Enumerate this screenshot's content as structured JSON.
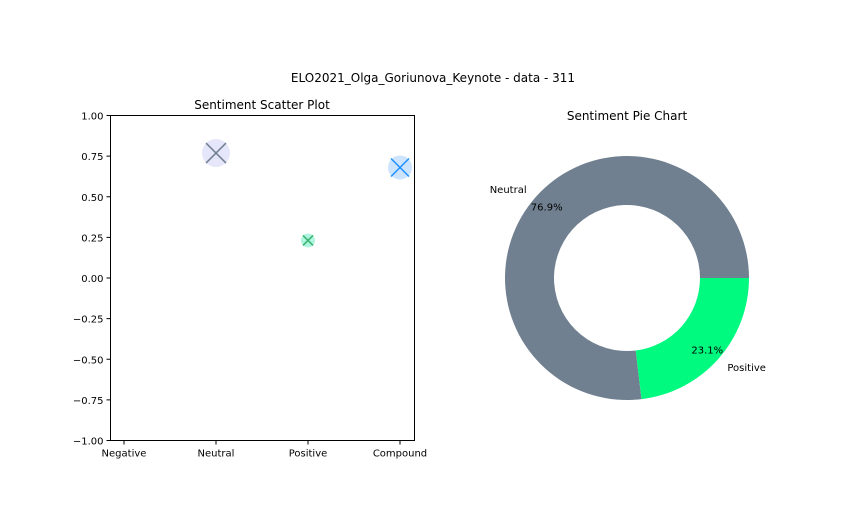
{
  "figure": {
    "suptitle": "ELO2021_Olga_Goriunova_Keynote - data - 311"
  },
  "chart_data": [
    {
      "type": "scatter",
      "title": "Sentiment Scatter Plot",
      "xlabel": "",
      "ylabel": "",
      "categories": [
        "Negative",
        "Neutral",
        "Positive",
        "Compound"
      ],
      "ylim": [
        -1.0,
        1.0
      ],
      "yticks": [
        "1.00",
        "0.75",
        "0.50",
        "0.25",
        "0.00",
        "−0.25",
        "−0.50",
        "−0.75",
        "−1.00"
      ],
      "yticks_values": [
        1.0,
        0.75,
        0.5,
        0.25,
        0.0,
        -0.25,
        -0.5,
        -0.75,
        -1.0
      ],
      "points": [
        {
          "category": "Neutral",
          "value": 0.769,
          "marker": "x",
          "color": "#708090",
          "halo": "#e6e6fa",
          "size": "large"
        },
        {
          "category": "Positive",
          "value": 0.231,
          "marker": "x",
          "color": "#3cb371",
          "halo": "#aff5e0",
          "size": "small"
        },
        {
          "category": "Compound",
          "value": 0.68,
          "marker": "x",
          "color": "#1e90ff",
          "halo": "#cde4ff",
          "size": "medium"
        }
      ]
    },
    {
      "type": "pie",
      "title": "Sentiment Pie Chart",
      "donut": true,
      "slices": [
        {
          "label": "Neutral",
          "value": 76.9,
          "pct_label": "76.9%",
          "color": "#708090"
        },
        {
          "label": "Positive",
          "value": 23.1,
          "pct_label": "23.1%",
          "color": "#00fa7f"
        }
      ]
    }
  ]
}
